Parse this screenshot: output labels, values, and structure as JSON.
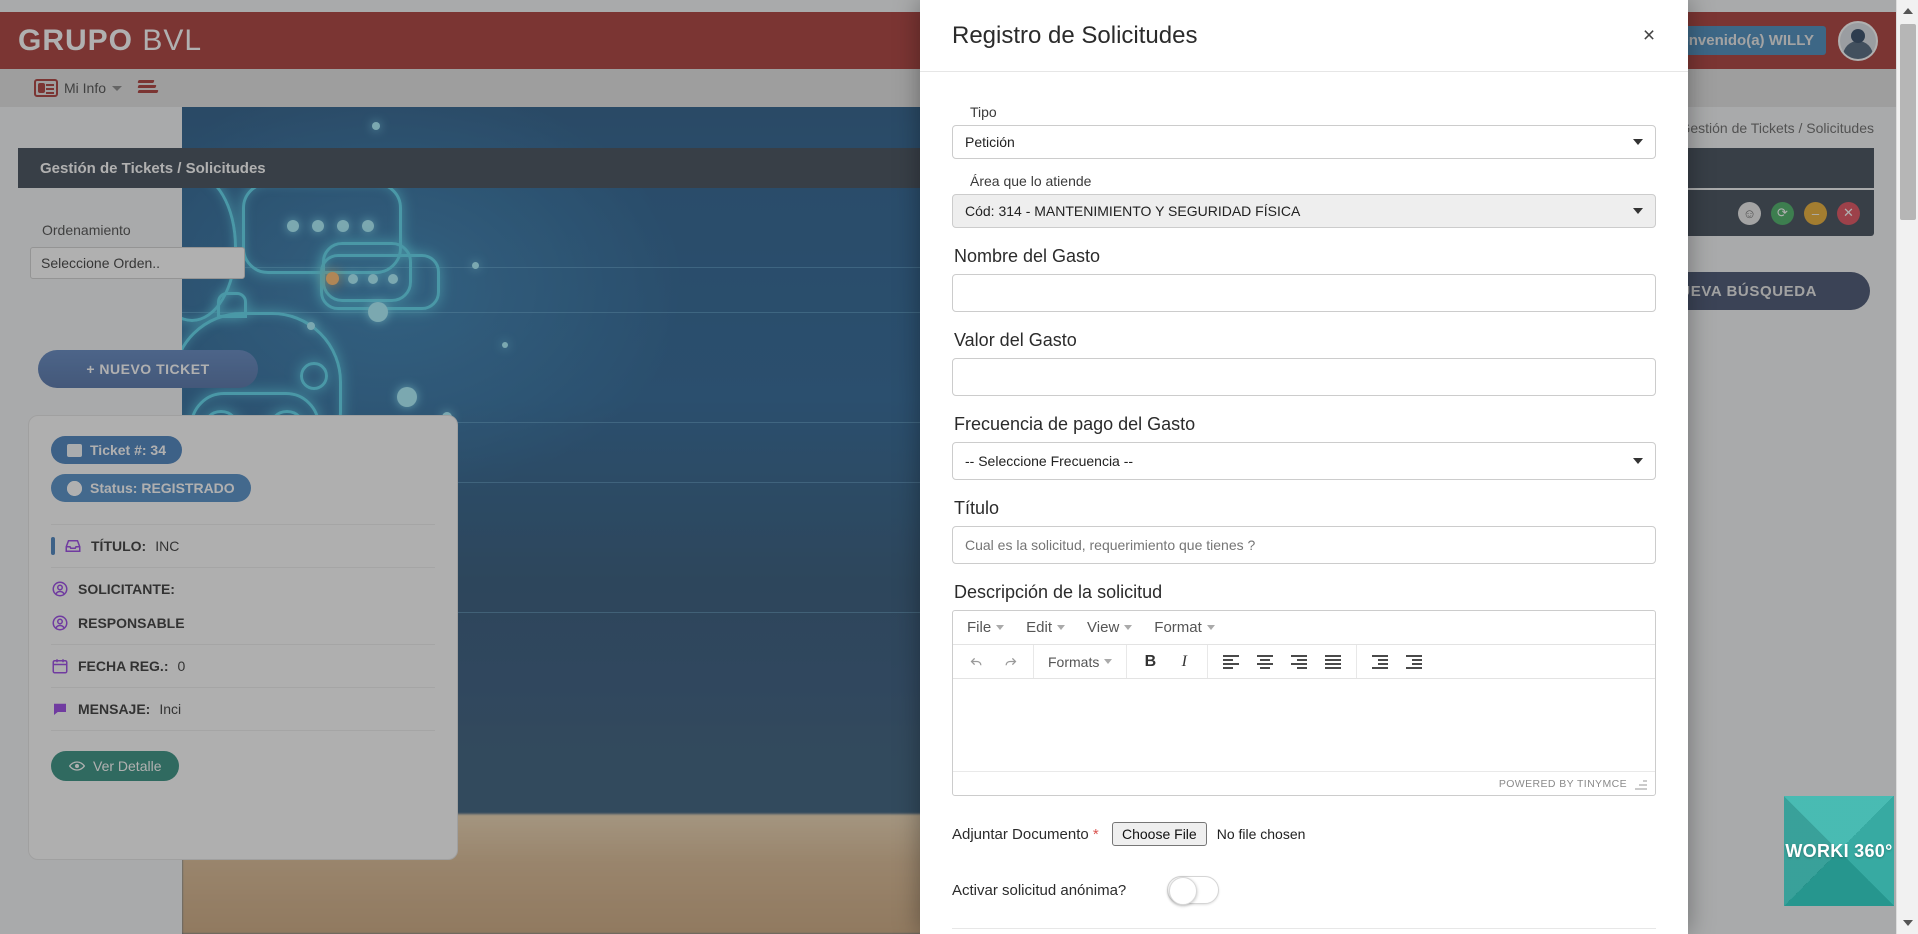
{
  "app": {
    "brand_strong": "GRUPO",
    "brand_light": "BVL",
    "welcome": "Bienvenido(a) WILLY",
    "menu": [
      {
        "label": "Mi Info",
        "icon": "id-card-icon"
      }
    ],
    "breadcrumb": "Gestión de Tickets / Solicitudes",
    "panel_title": "Gestión de Tickets / Solicitudes",
    "order_label": "Ordenamiento",
    "order_value": "Seleccione Orden..",
    "new_ticket_button": "+ NUEVO TICKET",
    "new_search_button": "NUEVA BÚSQUEDA",
    "window_actions": [
      "emoji-icon",
      "refresh-icon",
      "minimize-icon",
      "close-icon"
    ]
  },
  "ticket": {
    "number_chip": "Ticket #: 34",
    "status_chip": "Status: REGISTRADO",
    "titulo_label": "TÍTULO:",
    "titulo_value": "INC",
    "solicitante_label": "SOLICITANTE:",
    "solicitante_value": "",
    "responsable_label": "RESPONSABLE",
    "responsable_value": "",
    "fecha_label": "FECHA REG.:",
    "fecha_value": "0",
    "mensaje_label": "MENSAJE:",
    "mensaje_value": "Inci",
    "detail_button": "Ver Detalle"
  },
  "modal": {
    "title": "Registro de Solicitudes",
    "close_icon": "×",
    "fields": {
      "tipo_label": "Tipo",
      "tipo_value": "Petición",
      "area_label": "Área que lo atiende",
      "area_value": "Cód: 314 - MANTENIMIENTO Y SEGURIDAD FÍSICA",
      "nombre_gasto_label": "Nombre del Gasto",
      "nombre_gasto_value": "",
      "valor_gasto_label": "Valor del Gasto",
      "valor_gasto_value": "",
      "frecuencia_label": "Frecuencia de pago del Gasto",
      "frecuencia_value": "-- Seleccione Frecuencia --",
      "titulo_label": "Título",
      "titulo_placeholder": "Cual es la solicitud, requerimiento que tienes ?",
      "titulo_value": "",
      "descripcion_label": "Descripción de la solicitud",
      "adjuntar_label": "Adjuntar Documento",
      "adjuntar_required": "*",
      "choose_file_button": "Choose File",
      "no_file_text": "No file chosen",
      "anonima_label": "Activar solicitud anónima?",
      "anonima_state": "off"
    },
    "editor": {
      "menus": [
        "File",
        "Edit",
        "View",
        "Format"
      ],
      "formats_label": "Formats",
      "toolbar_icons": [
        "undo-icon",
        "redo-icon",
        "formats-dropdown",
        "bold-icon",
        "italic-icon",
        "align-left-icon",
        "align-center-icon",
        "align-right-icon",
        "align-justify-icon",
        "outdent-icon",
        "indent-icon"
      ],
      "status_text": "POWERED BY TINYMCE",
      "content": ""
    }
  },
  "worki": {
    "label": "WORKI 360°"
  },
  "colors": {
    "brand_red": "#9e1f1c",
    "panel_dark": "#263241",
    "accent_blue": "#2f6fb5",
    "teal": "#2aa79e",
    "status_green": "#2ea44f",
    "status_orange": "#e8a317",
    "status_red": "#dc3545"
  }
}
